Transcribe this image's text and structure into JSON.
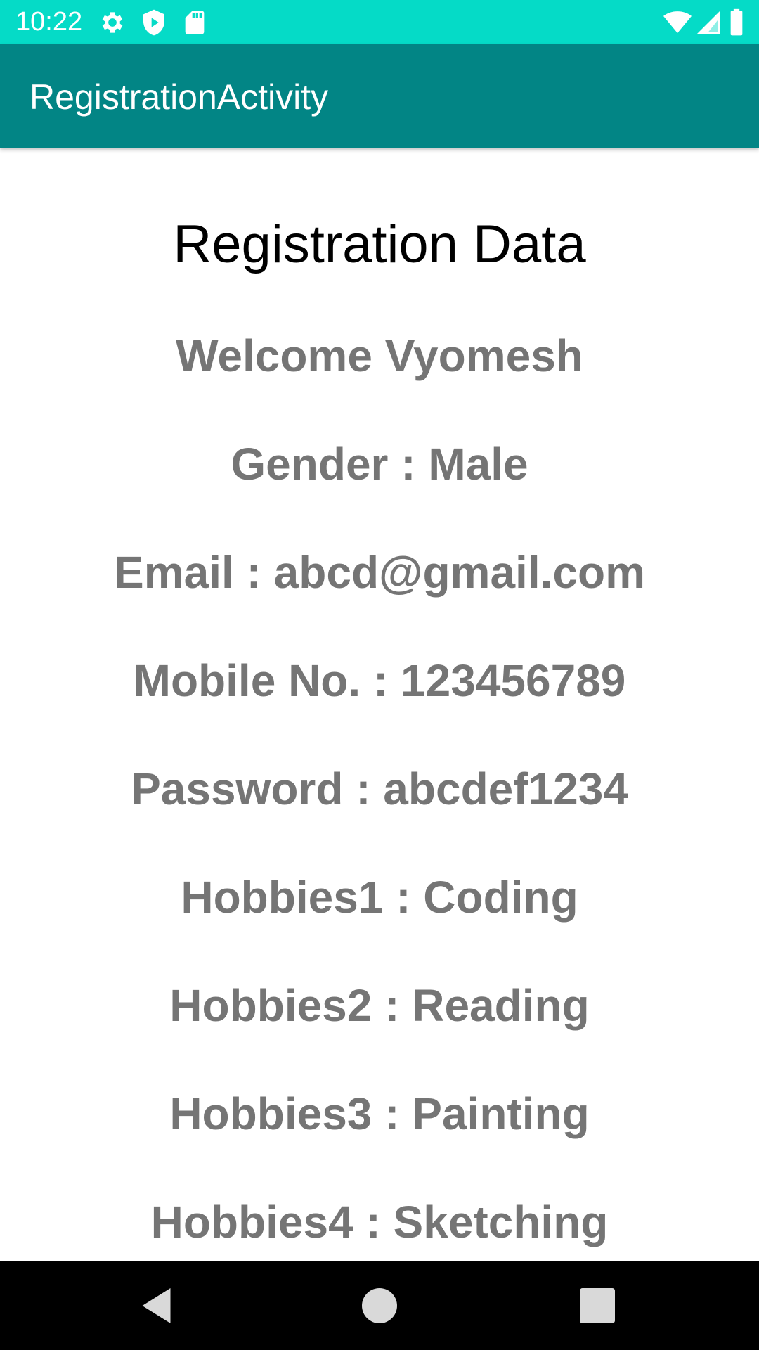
{
  "status_bar": {
    "time": "10:22",
    "background": "#05DBC7",
    "icons_left": [
      "gear-icon",
      "shield-play-icon",
      "sd-card-icon"
    ],
    "icons_right": [
      "wifi-icon",
      "cell-signal-icon",
      "battery-icon"
    ]
  },
  "app_bar": {
    "title": "RegistrationActivity",
    "background": "#028585"
  },
  "content": {
    "heading": "Registration Data",
    "lines": [
      "Welcome Vyomesh",
      "Gender : Male",
      "Email : abcd@gmail.com",
      "Mobile No. : 123456789",
      "Password : abcdef1234",
      "Hobbies1 : Coding",
      "Hobbies2 : Reading",
      "Hobbies3 : Painting",
      "Hobbies4 : Sketching"
    ],
    "text_color": "#757575"
  },
  "nav_bar": {
    "buttons": [
      "back-icon",
      "home-icon",
      "recents-icon"
    ]
  }
}
